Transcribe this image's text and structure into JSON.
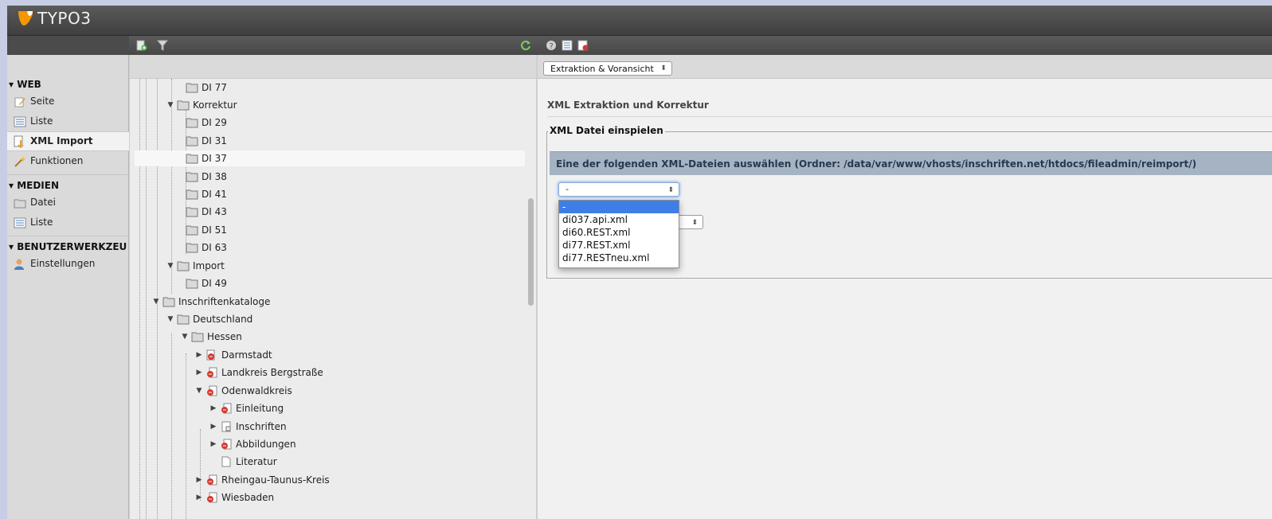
{
  "app": {
    "logo_text": "TYPO3",
    "brand_color": "#f49700"
  },
  "toolbar": {
    "icons": [
      "new-page-icon",
      "filter-icon",
      "refresh-icon",
      "help-icon",
      "list-icon",
      "clipboard-icon"
    ]
  },
  "module_menu": {
    "groups": [
      {
        "title": "WEB",
        "items": [
          {
            "label": "Seite",
            "icon": "page-edit-icon"
          },
          {
            "label": "Liste",
            "icon": "list-icon"
          },
          {
            "label": "XML Import",
            "icon": "xml-import-icon",
            "active": true
          },
          {
            "label": "Funktionen",
            "icon": "wand-icon"
          }
        ]
      },
      {
        "title": "MEDIEN",
        "items": [
          {
            "label": "Datei",
            "icon": "folder-icon"
          },
          {
            "label": "Liste",
            "icon": "list-icon"
          }
        ]
      },
      {
        "title": "BENUTZERWERKZEU",
        "items": [
          {
            "label": "Einstellungen",
            "icon": "user-settings-icon"
          }
        ]
      }
    ]
  },
  "tree": {
    "nodes": [
      {
        "label": "DI 77"
      },
      {
        "label": "Korrektur"
      },
      {
        "label": "DI 29"
      },
      {
        "label": "DI 31"
      },
      {
        "label": "DI 37"
      },
      {
        "label": "DI 38"
      },
      {
        "label": "DI 41"
      },
      {
        "label": "DI 43"
      },
      {
        "label": "DI 51"
      },
      {
        "label": "DI 63"
      },
      {
        "label": "Import"
      },
      {
        "label": "DI 49"
      },
      {
        "label": "Inschriftenkataloge"
      },
      {
        "label": "Deutschland"
      },
      {
        "label": "Hessen"
      },
      {
        "label": "Darmstadt"
      },
      {
        "label": "Landkreis Bergstraße"
      },
      {
        "label": "Odenwaldkreis"
      },
      {
        "label": "Einleitung"
      },
      {
        "label": "Inschriften"
      },
      {
        "label": "Abbildungen"
      },
      {
        "label": "Literatur"
      },
      {
        "label": "Rheingau-Taunus-Kreis"
      },
      {
        "label": "Wiesbaden"
      }
    ]
  },
  "content": {
    "function_select": "Extraktion & Voransicht",
    "heading": "XML Extraktion und Korrektur",
    "fieldset_legend": "XML Datei einspielen",
    "instruction": "Eine der folgenden XML-Dateien auswählen (Ordner: /data/var/www/vhosts/inschriften.net/htdocs/fileadmin/reimport/)",
    "file_select_value": "-",
    "file_options": [
      "-",
      "di037.api.xml",
      "di60.REST.xml",
      "di77.REST.xml",
      "di77.RESTneu.xml"
    ]
  }
}
